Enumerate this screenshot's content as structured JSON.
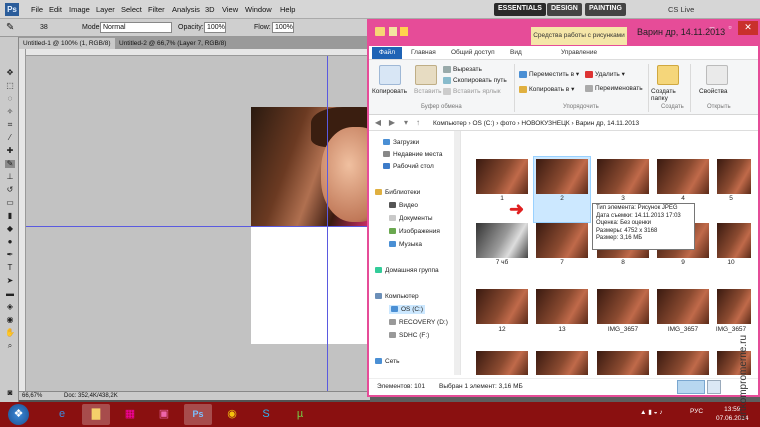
{
  "photoshop": {
    "logo": "Ps",
    "menu": [
      "File",
      "Edit",
      "Image",
      "Layer",
      "Select",
      "Filter",
      "Analysis",
      "3D",
      "View",
      "Window",
      "Help"
    ],
    "workspaces": [
      "ESSENTIALS",
      "DESIGN",
      "PAINTING"
    ],
    "cs_live": "CS Live",
    "options": {
      "brush_size": "38",
      "mode_label": "Mode:",
      "mode_value": "Normal",
      "opacity_label": "Opacity:",
      "opacity_value": "100%",
      "flow_label": "Flow:",
      "flow_value": "100%"
    },
    "tabs": [
      "Untitled-1 @ 100% (1, RGB/8)",
      "Untitled-2 @ 66,7% (Layer 7, RGB/8)"
    ],
    "status": "Doc: 352,4K/438,2K",
    "zoom": "66,67%"
  },
  "explorer": {
    "title": "Варин др, 14.11.2013",
    "context_tab": "Средства работы с рисунками",
    "ribbon_tabs": [
      "Файл",
      "Главная",
      "Общий доступ",
      "Вид",
      "Управление"
    ],
    "ribbon": {
      "copy": "Копировать",
      "paste": "Вставить",
      "cut": "Вырезать",
      "copy_path": "Скопировать путь",
      "paste_shortcut": "Вставить ярлык",
      "move_to": "Переместить в",
      "copy_to": "Копировать в",
      "delete": "Удалить",
      "rename": "Переименовать",
      "new_folder": "Создать папку",
      "properties": "Свойства",
      "group_clipboard": "Буфер обмена",
      "group_organize": "Упорядочить",
      "group_create": "Создать",
      "group_open": "Открыть"
    },
    "path": [
      "Компьютер",
      "OS (C:)",
      "фото",
      "НОВОКУЗНЕЦК",
      "Варин др, 14.11.2013"
    ],
    "nav": [
      {
        "label": "Загрузки",
        "sub": false
      },
      {
        "label": "Недавние места",
        "sub": false
      },
      {
        "label": "Рабочий стол",
        "sub": false
      },
      {
        "label": "Библиотеки",
        "sub": false
      },
      {
        "label": "Видео",
        "sub": true
      },
      {
        "label": "Документы",
        "sub": true
      },
      {
        "label": "Изображения",
        "sub": true
      },
      {
        "label": "Музыка",
        "sub": true
      },
      {
        "label": "Домашняя группа",
        "sub": false
      },
      {
        "label": "Компьютер",
        "sub": false
      },
      {
        "label": "OS (C:)",
        "sub": true
      },
      {
        "label": "RECOVERY (D:)",
        "sub": true
      },
      {
        "label": "SDHC (F:)",
        "sub": true
      },
      {
        "label": "Сеть",
        "sub": false
      }
    ],
    "files": [
      "1",
      "2",
      "3",
      "4",
      "5",
      "7 чб",
      "7",
      "8",
      "9",
      "10",
      "12",
      "13",
      "IMG_3657",
      "IMG_3657",
      "IMG_3657"
    ],
    "tooltip": [
      "Тип элемента: Рисунок JPEG",
      "Дата съемки: 14.11.2013 17:03",
      "Оценка: Без оценки",
      "Размеры: 4752 x 3168",
      "Размер: 3,16 МБ"
    ],
    "status_items": "Элементов: 101",
    "status_selected": "Выбран 1 элемент: 3,16 МБ"
  },
  "taskbar": {
    "lang": "РУС",
    "time": "13:59",
    "date": "07.06.2014"
  },
  "watermark": "artkompromerne.ru"
}
